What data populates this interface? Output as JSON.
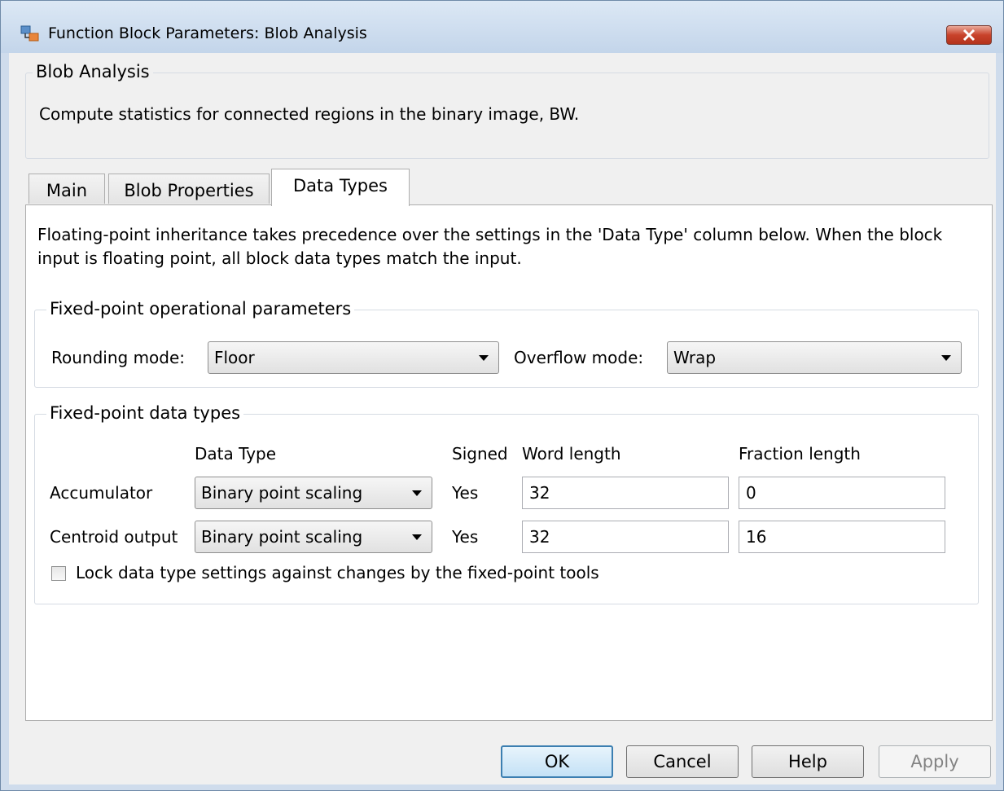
{
  "window": {
    "title": "Function Block Parameters: Blob Analysis"
  },
  "description": {
    "group_title": "Blob Analysis",
    "text": "Compute statistics for connected regions in the binary image, BW."
  },
  "tabs": [
    {
      "label": "Main",
      "active": false
    },
    {
      "label": "Blob Properties",
      "active": false
    },
    {
      "label": "Data Types",
      "active": true
    }
  ],
  "data_types": {
    "intro": "Floating-point inheritance takes precedence over the settings in the 'Data Type' column below. When the block input is floating point, all block data types match the input.",
    "operational": {
      "title": "Fixed-point operational parameters",
      "rounding_label": "Rounding mode:",
      "rounding_value": "Floor",
      "overflow_label": "Overflow mode:",
      "overflow_value": "Wrap"
    },
    "fixed_types": {
      "title": "Fixed-point data types",
      "headers": {
        "data_type": "Data Type",
        "signed": "Signed",
        "word_length": "Word length",
        "fraction_length": "Fraction length"
      },
      "rows": [
        {
          "name": "Accumulator",
          "data_type": "Binary point scaling",
          "signed": "Yes",
          "word_length": "32",
          "fraction_length": "0"
        },
        {
          "name": "Centroid output",
          "data_type": "Binary point scaling",
          "signed": "Yes",
          "word_length": "32",
          "fraction_length": "16"
        }
      ],
      "lock_label": "Lock data type settings against changes by the fixed-point tools",
      "lock_checked": false
    }
  },
  "buttons": {
    "ok": "OK",
    "cancel": "Cancel",
    "help": "Help",
    "apply": "Apply"
  }
}
